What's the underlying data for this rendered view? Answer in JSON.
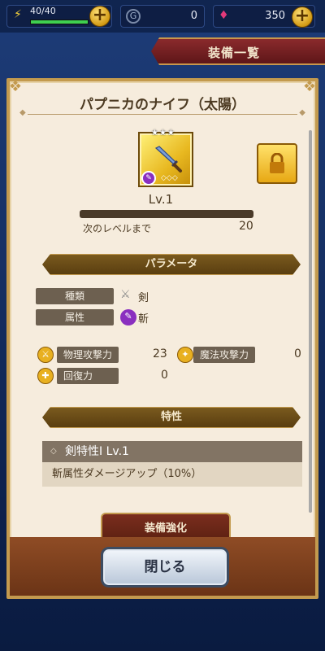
{
  "topbar": {
    "stamina": "40/40",
    "stamina_fraction": 1.0,
    "currency1": "0",
    "currency2": "350"
  },
  "header": {
    "title": "装備一覧"
  },
  "item": {
    "name": "パプニカのナイフ（太陽）",
    "rarity_stars": "★★★",
    "level": "Lv.1",
    "exp_fraction": 0.0,
    "next_label": "次のレベルまで",
    "next_value": "20"
  },
  "params": {
    "header": "パラメータ",
    "type_label": "種類",
    "type_value": "剣",
    "attr_label": "属性",
    "attr_value": "斬",
    "phys_label": "物理攻撃力",
    "phys_value": "23",
    "magic_label": "魔法攻撃力",
    "magic_value": "0",
    "heal_label": "回復力",
    "heal_value": "0"
  },
  "traits": {
    "header": "特性",
    "name": "剣特性Ⅰ Lv.1",
    "desc": "斬属性ダメージアップ（10%）"
  },
  "buttons": {
    "enhance": "装備強化",
    "close": "閉じる"
  },
  "colors": {
    "panel_bg": "#f6ecdd",
    "gold_border": "#c39a4e",
    "header_red": "#8a2a2c",
    "slash_purple": "#8a2fbf",
    "stamina_green": "#3fd050"
  },
  "icons": {
    "stamina": "lightning-icon",
    "coin": "coin-icon",
    "gem": "gem-icon",
    "lock": "lock-icon",
    "sword": "sword-icon"
  }
}
